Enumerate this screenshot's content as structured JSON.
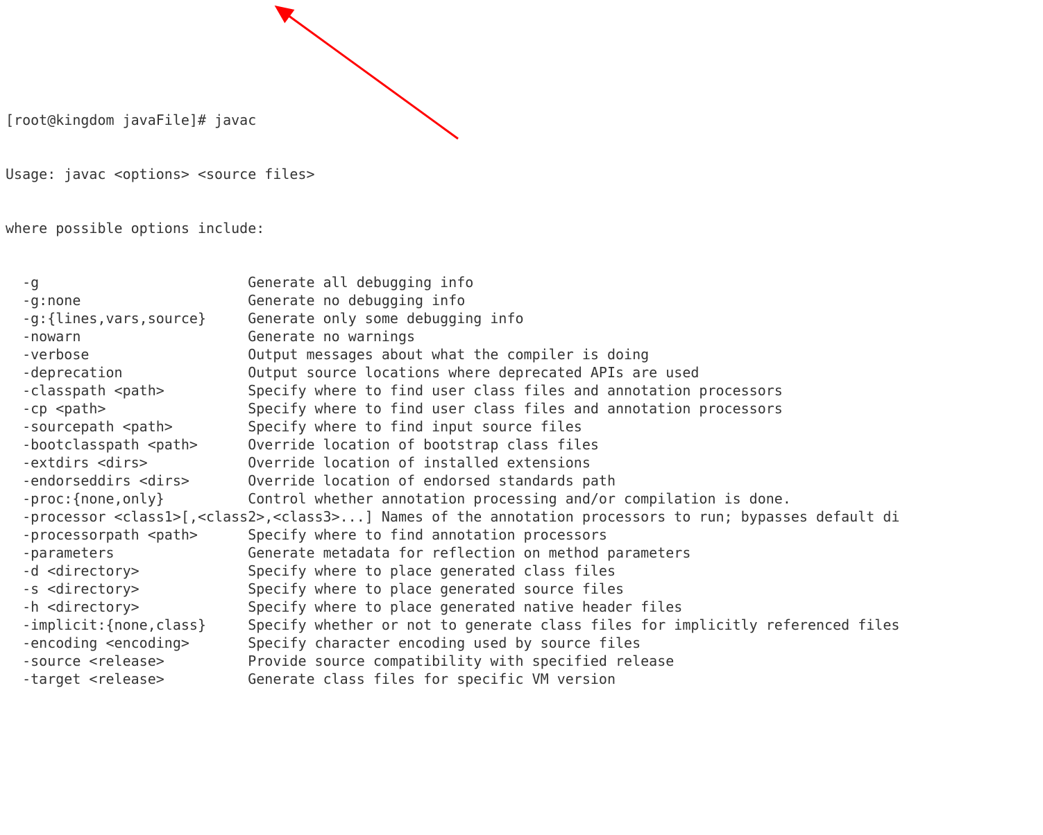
{
  "terminal": {
    "prompt": "[root@kingdom javaFile]# ",
    "command": "javac",
    "usageLine": "Usage: javac <options> <source files>",
    "whereLine": "where possible options include:",
    "options": [
      {
        "flag": "  -g                         ",
        "desc": "Generate all debugging info"
      },
      {
        "flag": "  -g:none                    ",
        "desc": "Generate no debugging info"
      },
      {
        "flag": "  -g:{lines,vars,source}     ",
        "desc": "Generate only some debugging info"
      },
      {
        "flag": "  -nowarn                    ",
        "desc": "Generate no warnings"
      },
      {
        "flag": "  -verbose                   ",
        "desc": "Output messages about what the compiler is doing"
      },
      {
        "flag": "  -deprecation               ",
        "desc": "Output source locations where deprecated APIs are used"
      },
      {
        "flag": "  -classpath <path>          ",
        "desc": "Specify where to find user class files and annotation processors"
      },
      {
        "flag": "  -cp <path>                 ",
        "desc": "Specify where to find user class files and annotation processors"
      },
      {
        "flag": "  -sourcepath <path>         ",
        "desc": "Specify where to find input source files"
      },
      {
        "flag": "  -bootclasspath <path>      ",
        "desc": "Override location of bootstrap class files"
      },
      {
        "flag": "  -extdirs <dirs>            ",
        "desc": "Override location of installed extensions"
      },
      {
        "flag": "  -endorseddirs <dirs>       ",
        "desc": "Override location of endorsed standards path"
      },
      {
        "flag": "  -proc:{none,only}          ",
        "desc": "Control whether annotation processing and/or compilation is done."
      },
      {
        "flag": "  -processor <class1>[,<class2>,<class3>...] ",
        "desc": "Names of the annotation processors to run; bypasses default di"
      },
      {
        "flag": "  -processorpath <path>      ",
        "desc": "Specify where to find annotation processors"
      },
      {
        "flag": "  -parameters                ",
        "desc": "Generate metadata for reflection on method parameters"
      },
      {
        "flag": "  -d <directory>             ",
        "desc": "Specify where to place generated class files"
      },
      {
        "flag": "  -s <directory>             ",
        "desc": "Specify where to place generated source files"
      },
      {
        "flag": "  -h <directory>             ",
        "desc": "Specify where to place generated native header files"
      },
      {
        "flag": "  -implicit:{none,class}     ",
        "desc": "Specify whether or not to generate class files for implicitly referenced files"
      },
      {
        "flag": "  -encoding <encoding>       ",
        "desc": "Specify character encoding used by source files"
      },
      {
        "flag": "  -source <release>          ",
        "desc": "Provide source compatibility with specified release"
      },
      {
        "flag": "  -target <release>          ",
        "desc": "Generate class files for specific VM version"
      }
    ]
  },
  "annotation": {
    "arrowColor": "#ff0000"
  }
}
